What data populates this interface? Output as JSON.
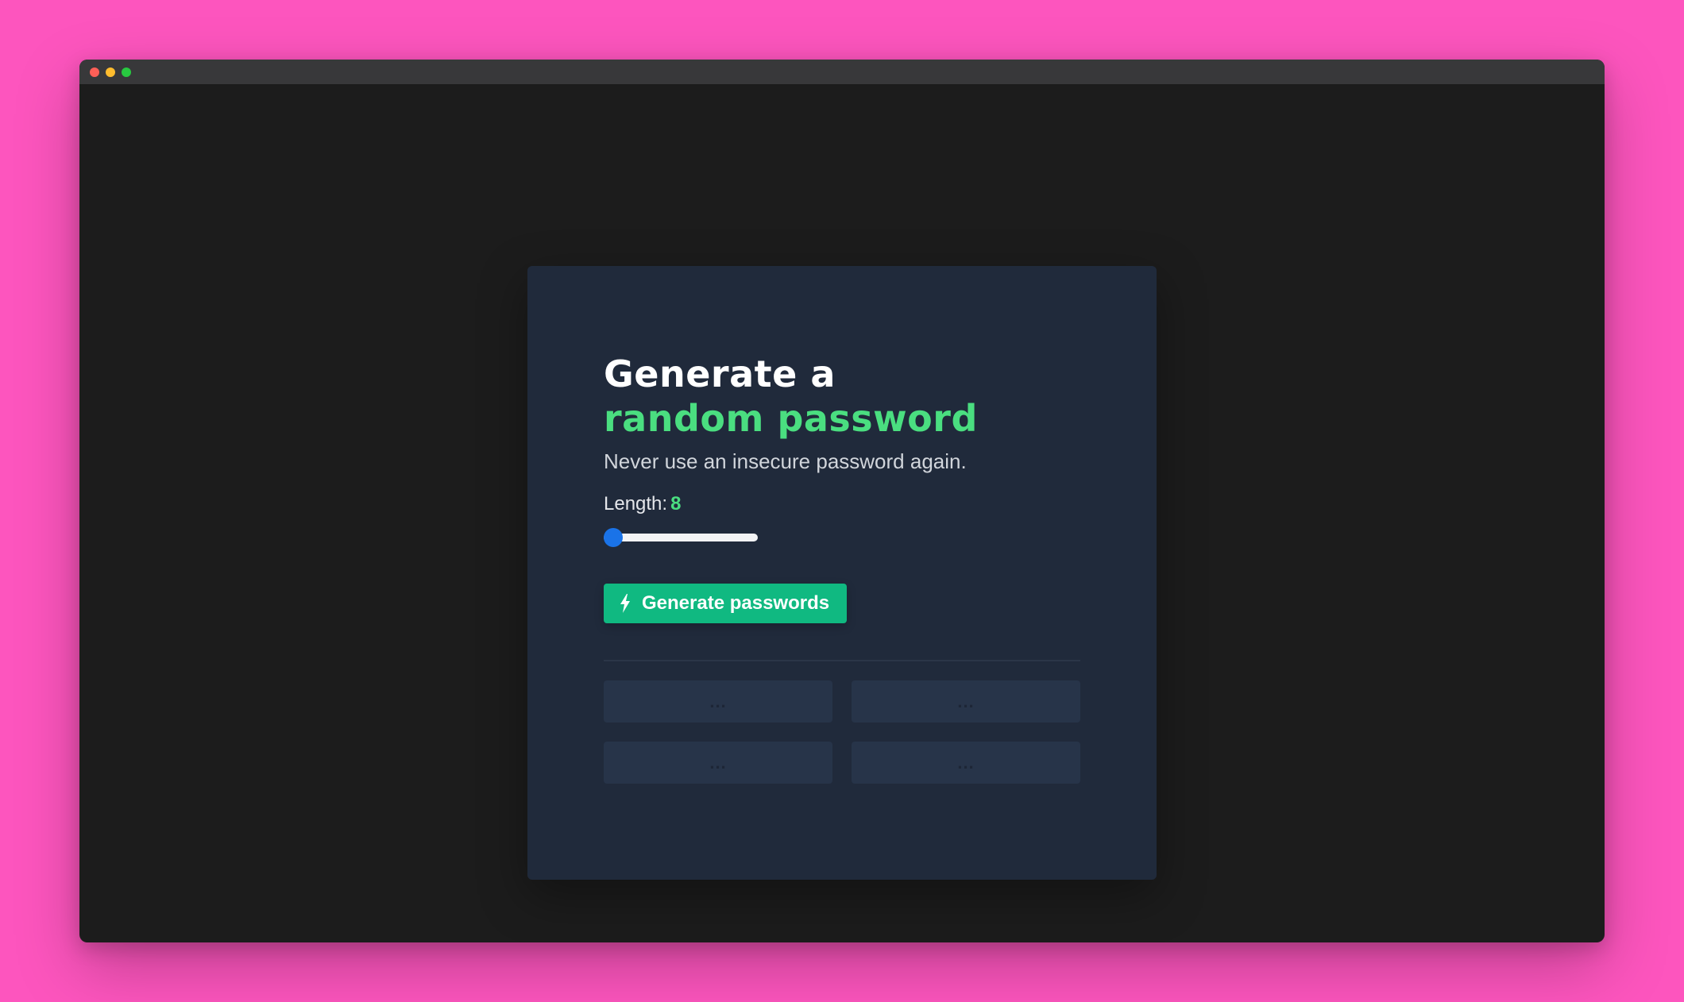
{
  "window": {
    "controls": [
      "close",
      "minimize",
      "maximize"
    ]
  },
  "card": {
    "heading_line1": "Generate a",
    "heading_line2": "random password",
    "subtitle": "Never use an insecure password again.",
    "length_label": "Length:",
    "length_value": "8",
    "slider_level": 0,
    "button_label": "Generate passwords",
    "button_icon": "lightning-bolt-icon"
  },
  "passwords": [
    {
      "placeholder": "..."
    },
    {
      "placeholder": "..."
    },
    {
      "placeholder": "..."
    },
    {
      "placeholder": "..."
    }
  ],
  "colors": {
    "page_background": "#fd55be",
    "window_background": "#1c1c1c",
    "card_background": "#202a3b",
    "accent_green": "#4ade80",
    "button_green": "#10b981",
    "slider_thumb": "#1a73e8"
  }
}
